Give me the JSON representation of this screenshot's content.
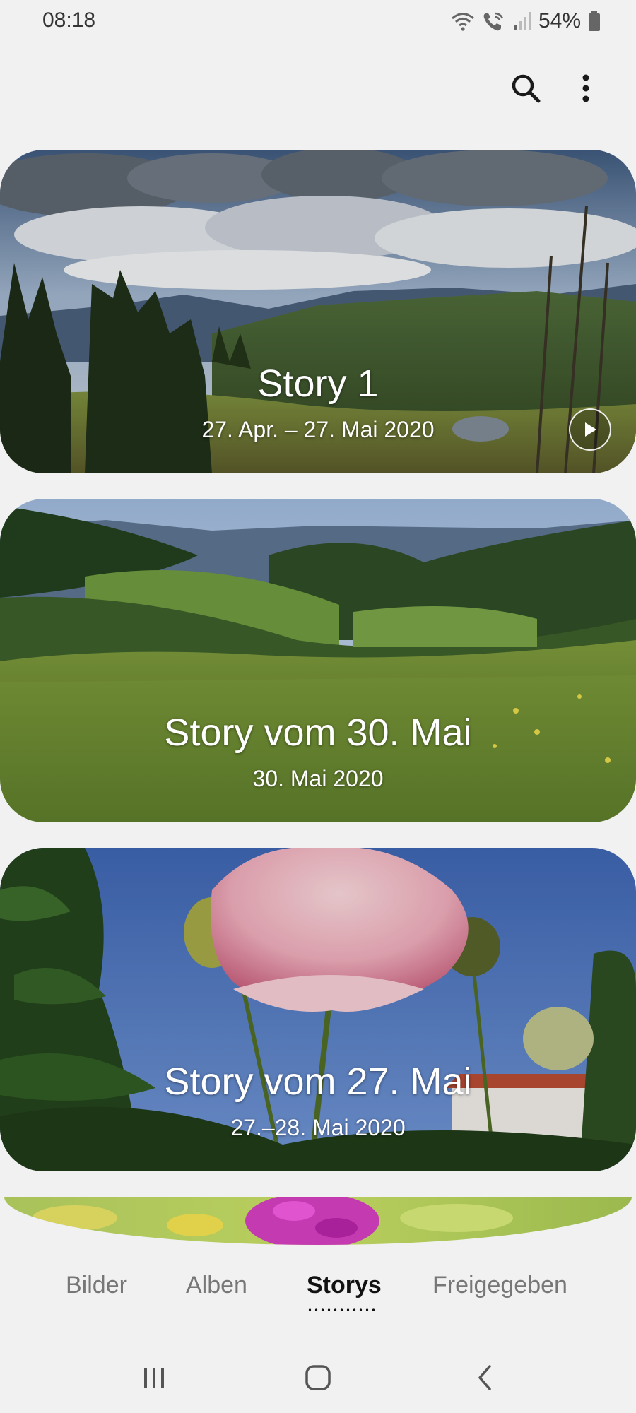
{
  "status_bar": {
    "time": "08:18",
    "battery_percent": "54%",
    "icons": [
      "wifi-icon",
      "wifi-call-icon",
      "signal-icon",
      "battery-icon"
    ]
  },
  "action_bar": {
    "icons": [
      "search-icon",
      "more-options-icon"
    ]
  },
  "stories": [
    {
      "title": "Story 1",
      "date": "27. Apr. – 27. Mai 2020",
      "has_play_button": true
    },
    {
      "title": "Story vom 30. Mai",
      "date": "30. Mai 2020"
    },
    {
      "title": "Story vom 27. Mai",
      "date": "27.–28. Mai 2020"
    },
    {
      "title": "",
      "date": ""
    }
  ],
  "tabs": [
    {
      "label": "Bilder",
      "selected": false
    },
    {
      "label": "Alben",
      "selected": false
    },
    {
      "label": "Storys",
      "selected": true
    },
    {
      "label": "Freigegeben",
      "selected": false
    }
  ],
  "nav_bar": {
    "icons": [
      "recent-apps-icon",
      "home-icon",
      "back-icon"
    ]
  },
  "colors": {
    "background": "#f1f1f1",
    "tab_selected": "#111111",
    "tab_unselected": "#777777"
  }
}
